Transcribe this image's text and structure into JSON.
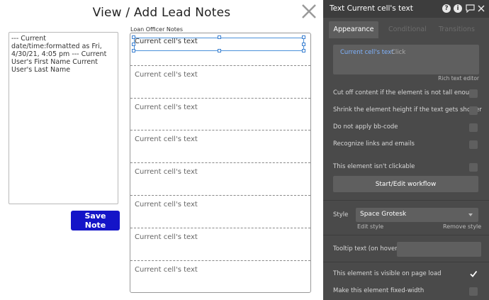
{
  "canvas": {
    "title": "View / Add Lead Notes",
    "notes_text": "--- Current date/time:formatted as Fri, 4/30/21, 4:05 pm --- Current User's First Name Current User's Last Name",
    "save_label": "Save Note",
    "list_label": "Loan Officer Notes",
    "cells": [
      "Current cell's text",
      "Current cell's text",
      "Current cell's text",
      "Current cell's text",
      "Current cell's text",
      "Current cell's text",
      "Current cell's text",
      "Current cell's text"
    ]
  },
  "panel": {
    "title": "Text Current cell's text",
    "header_icons": [
      "help-icon",
      "info-icon",
      "comment-icon",
      "close-icon"
    ],
    "tabs": [
      "Appearance",
      "Conditional",
      "Transitions"
    ],
    "active_tab": "Appearance",
    "rich_text": {
      "chip": "Current cell's text",
      "click_hint": "Click",
      "editor_link": "Rich text editor"
    },
    "options": [
      {
        "label": "Cut off content if the element is not tall enough",
        "checked": false
      },
      {
        "label": "Shrink the element height if the text gets shorter",
        "checked": false
      },
      {
        "label": "Do not apply bb-code",
        "checked": false
      },
      {
        "label": "Recognize links and emails",
        "checked": false
      },
      {
        "label": "This element isn't clickable",
        "checked": false
      }
    ],
    "workflow_button": "Start/Edit workflow",
    "style_label": "Style",
    "style_value": "Space Grotesk",
    "edit_style": "Edit style",
    "remove_style": "Remove style",
    "tooltip_label": "Tooltip text (on hover)",
    "tooltip_value": "",
    "visible_label": "This element is visible on page load",
    "visible_checked": true,
    "fixed_width_label": "Make this element fixed-width",
    "fixed_width_checked": false,
    "colors": {
      "panel_bg": "#4a4a4a",
      "header_bg": "#3d3d3d",
      "field_bg": "#5f5f5f",
      "link": "#7fb3ff",
      "save_button": "#1414c8"
    }
  }
}
